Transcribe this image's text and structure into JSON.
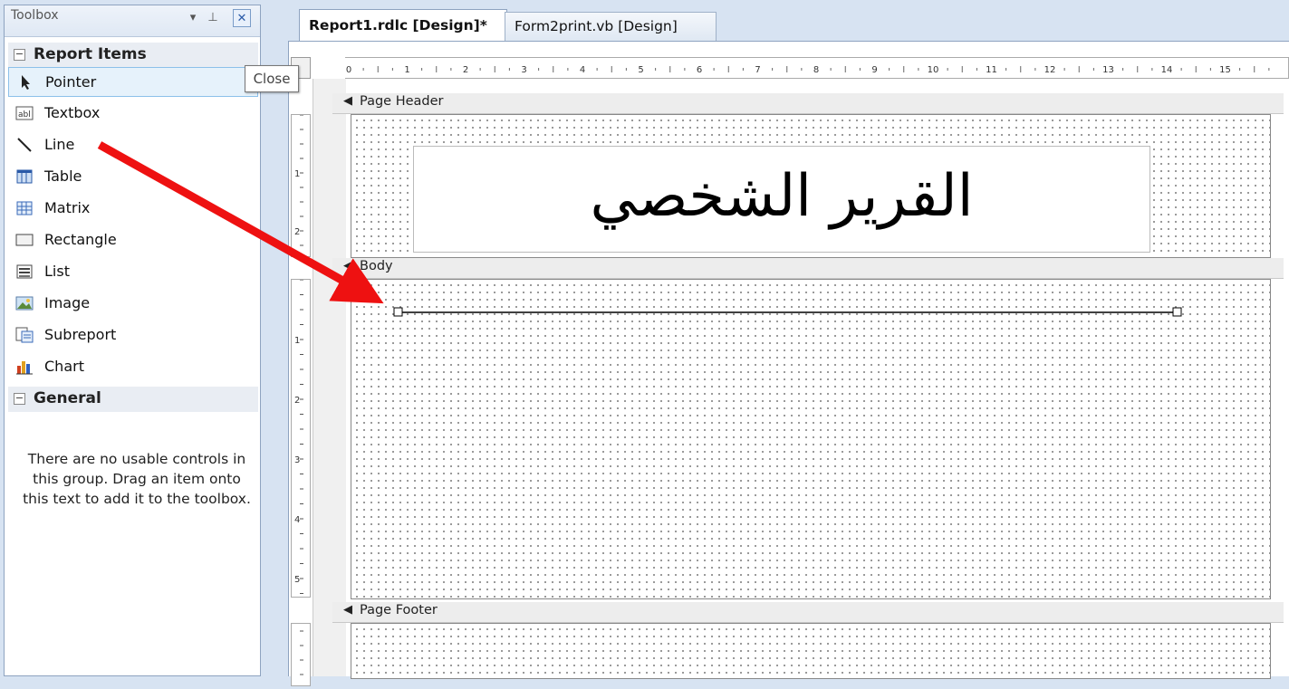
{
  "toolbox": {
    "title": "Toolbox",
    "pin_glyph": "▾ ⊥",
    "close_glyph": "✕",
    "categories": [
      {
        "label": "Report Items",
        "toggle": "−"
      },
      {
        "label": "General",
        "toggle": "−"
      }
    ],
    "items": [
      {
        "label": "Pointer",
        "icon": "pointer-icon"
      },
      {
        "label": "Textbox",
        "icon": "textbox-icon"
      },
      {
        "label": "Line",
        "icon": "line-icon"
      },
      {
        "label": "Table",
        "icon": "table-icon"
      },
      {
        "label": "Matrix",
        "icon": "matrix-icon"
      },
      {
        "label": "Rectangle",
        "icon": "rectangle-icon"
      },
      {
        "label": "List",
        "icon": "list-icon"
      },
      {
        "label": "Image",
        "icon": "image-icon"
      },
      {
        "label": "Subreport",
        "icon": "subreport-icon"
      },
      {
        "label": "Chart",
        "icon": "chart-icon"
      }
    ],
    "selected_item": "Pointer",
    "empty_message": "There are no usable controls in this group. Drag an item onto this text to add it to the toolbox.",
    "tooltip": "Close"
  },
  "tabs": [
    {
      "label": "Report1.rdlc [Design]*",
      "active": true
    },
    {
      "label": "Form2print.vb [Design]",
      "active": false
    }
  ],
  "designer": {
    "ruler_h": [
      "0",
      "1",
      "2",
      "3",
      "4",
      "5",
      "6",
      "7",
      "8",
      "9",
      "10",
      "11",
      "12",
      "13",
      "14",
      "15"
    ],
    "ruler_v_header": [
      "1",
      "2"
    ],
    "ruler_v_body": [
      "1",
      "2",
      "3",
      "4",
      "5"
    ],
    "bands": {
      "header": "Page Header",
      "body": "Body",
      "footer": "Page Footer"
    },
    "header_title": "القرير الشخصي",
    "band_glyph": "🡇"
  },
  "colors": {
    "arrow": "#ee1111",
    "selection": "#8cc0ea"
  }
}
